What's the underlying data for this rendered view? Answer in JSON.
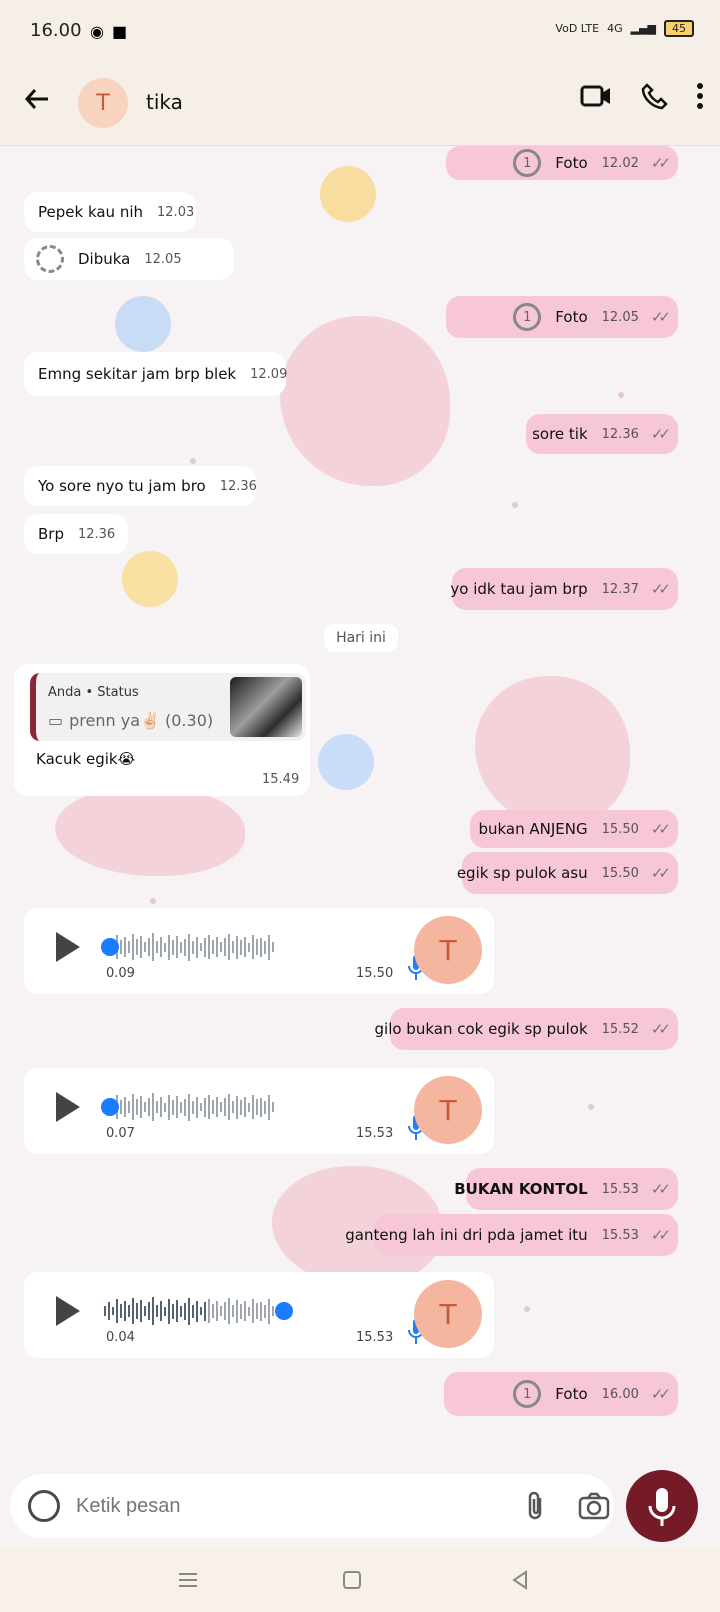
{
  "status": {
    "time": "16.00",
    "network_left": "VoD LTE",
    "network_right": "4G",
    "battery": "45"
  },
  "header": {
    "avatar_letter": "T",
    "contact_name": "tika"
  },
  "messages": [
    {
      "side": "out",
      "text": "Foto",
      "time": "12.02",
      "kind": "view_once"
    },
    {
      "side": "in",
      "text": "Pepek kau nih",
      "time": "12.03"
    },
    {
      "side": "in",
      "text": "Dibuka",
      "time": "12.05",
      "kind": "opened"
    },
    {
      "side": "out",
      "text": "Foto",
      "time": "12.05",
      "kind": "view_once"
    },
    {
      "side": "in",
      "text": "Emng sekitar jam brp blek",
      "time": "12.09"
    },
    {
      "side": "out",
      "text": "sore tik",
      "time": "12.36"
    },
    {
      "side": "in",
      "text": "Yo sore nyo tu jam bro",
      "time": "12.36"
    },
    {
      "side": "in",
      "text": "Brp",
      "time": "12.36"
    },
    {
      "side": "out",
      "text": "yo idk tau jam brp",
      "time": "12.37"
    }
  ],
  "date_chip": "Hari ini",
  "reply": {
    "title": "Anda • Status",
    "body": "prenn ya✌🏻 (0.30)",
    "text": "Kacuk egik😭",
    "time": "15.49"
  },
  "outgoing_after": [
    {
      "text": "bukan ANJENG",
      "time": "15.50"
    },
    {
      "text": "egik sp pulok asu",
      "time": "15.50"
    }
  ],
  "voice": [
    {
      "elapsed": "0.09",
      "time": "15.50",
      "progress": 0.02,
      "avatar": "T"
    },
    {
      "elapsed": "0.07",
      "time": "15.53",
      "progress": 0.02,
      "avatar": "T"
    },
    {
      "elapsed": "0.04",
      "time": "15.53",
      "progress": 0.6,
      "avatar": "T"
    }
  ],
  "outgoing_late": [
    {
      "text": "gilo bukan cok egik sp pulok",
      "time": "15.52"
    },
    {
      "text": "BUKAN KONTOL",
      "time": "15.53"
    },
    {
      "text": "ganteng lah ini dri pda jamet itu",
      "time": "15.53"
    },
    {
      "text": "Foto",
      "time": "16.00"
    }
  ],
  "composer": {
    "placeholder": "Ketik pesan"
  },
  "colors": {
    "outgoing": "#f7c7d8",
    "accent": "#741b27",
    "voice_dot": "#1b7cff"
  }
}
